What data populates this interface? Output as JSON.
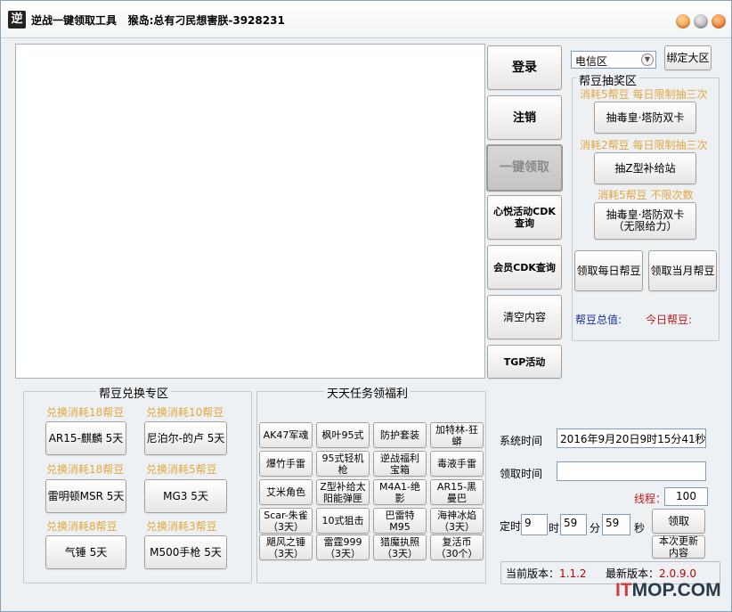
{
  "window": {
    "title": "逆战一键领取工具",
    "subtitle": "猴岛:总有刁民想害朕-3928231",
    "icon_glyph": "逆"
  },
  "main_buttons": {
    "login": "登录",
    "logout": "注销",
    "one_click": "一键领取",
    "xinyue_cdk": "心悦活动CDK查询",
    "member_cdk": "会员CDK查询",
    "clear": "清空内容",
    "tgp": "TGP活动"
  },
  "region": {
    "selected": "电信区",
    "bind_button": "绑定大区"
  },
  "lottery": {
    "title": "帮豆抽奖区",
    "items": [
      {
        "note": "消耗5帮豆  每日限制抽三次",
        "button": "抽毒皇·塔防双卡"
      },
      {
        "note": "消耗2帮豆  每日限制抽三次",
        "button": "抽Z型补给站"
      },
      {
        "note": "消耗5帮豆  不限次数",
        "button": "抽毒皇·塔防双卡（无限给力）"
      }
    ],
    "daily_button": "领取每日帮豆",
    "monthly_button": "领取当月帮豆",
    "total_label": "帮豆总值:",
    "today_label": "今日帮豆:"
  },
  "exchange": {
    "title": "帮豆兑换专区",
    "items": [
      {
        "note": "兑换消耗18帮豆",
        "button": "AR15-麒麟 5天"
      },
      {
        "note": "兑换消耗10帮豆",
        "button": "尼泊尔-的卢 5天"
      },
      {
        "note": "兑换消耗18帮豆",
        "button": "雷明顿MSR 5天"
      },
      {
        "note": "兑换消耗5帮豆",
        "button": "MG3 5天"
      },
      {
        "note": "兑换消耗8帮豆",
        "button": "气锤 5天"
      },
      {
        "note": "兑换消耗3帮豆",
        "button": "M500手枪 5天"
      }
    ]
  },
  "tasks": {
    "title": "天天任务领福利",
    "rows": [
      [
        "AK47军魂",
        "枫叶95式",
        "防护套装",
        "加特林-狂蟒"
      ],
      [
        "爆竹手雷",
        "95式轻机枪",
        "逆战福利宝箱",
        "毒液手雷"
      ],
      [
        "艾米角色",
        "Z型补给太阳能弹匣",
        "M4A1-绝影",
        "AR15-黑曼巴"
      ],
      [
        "Scar-朱雀（3天）",
        "10式狙击",
        "巴雷特M95",
        "海神冰焰（3天）"
      ],
      [
        "飓风之锤（3天）",
        "雷霆999（3天）",
        "猎魔执照（3天）",
        "复活币（30个）"
      ]
    ]
  },
  "schedule": {
    "system_time_label": "系统时间",
    "system_time_value": "2016年9月20日9时15分41秒",
    "claim_time_label": "领取时间",
    "claim_time_value": "",
    "thread_label": "线程：",
    "thread_value": "100",
    "timer_label": "定时",
    "hour_value": "9",
    "hour_unit": "时",
    "minute_value": "59",
    "minute_unit": "分",
    "second_value": "59",
    "second_unit": "秒",
    "claim_button": "领取",
    "update_button": "本次更新内容"
  },
  "version": {
    "current_label": "当前版本：",
    "current_value": "1.1.2",
    "latest_label": "最新版本：",
    "latest_value": "2.0.9.0",
    "label_color": "#000000",
    "value_color": "#c00000"
  },
  "watermark": {
    "accent": "IT",
    "rest": "MOP.COM"
  },
  "colors": {
    "orange_note": "#e3a63c",
    "total_label": "#1a2fa0",
    "today_label": "#c01a1a",
    "thread_label": "#c01a1a"
  }
}
